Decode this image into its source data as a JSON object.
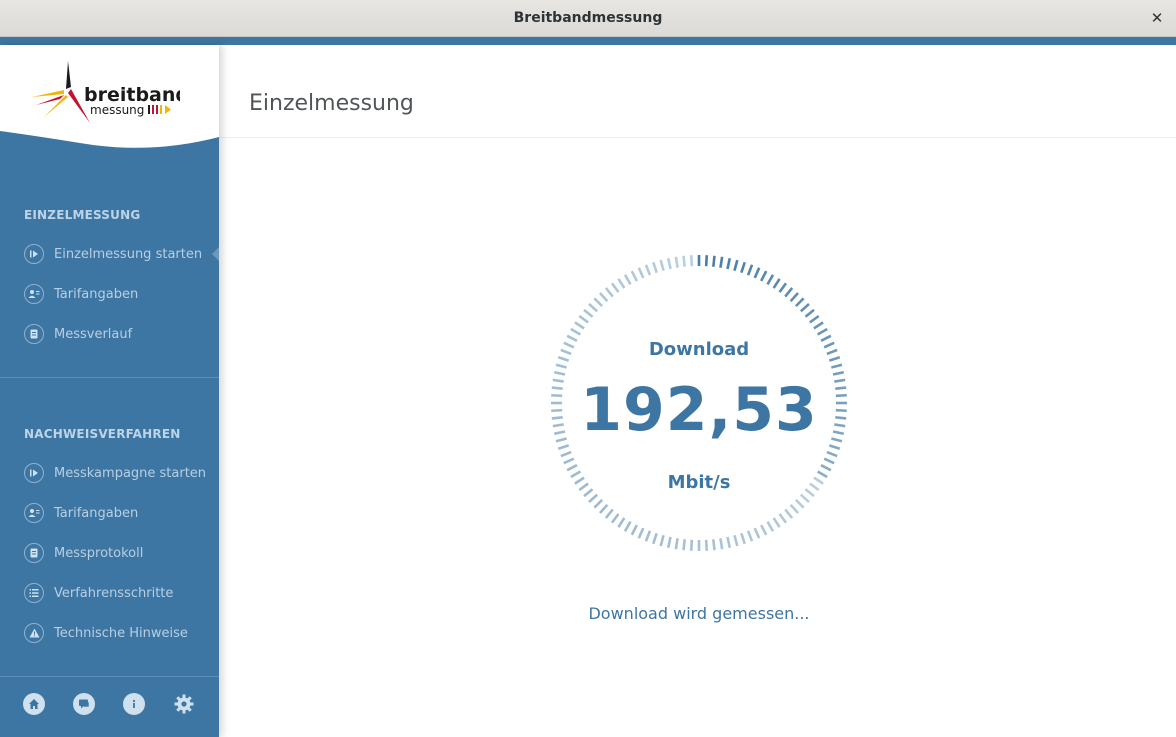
{
  "window": {
    "title": "Breitbandmessung",
    "close_glyph": "✕"
  },
  "logo": {
    "line1": "breitband",
    "line2": "messung"
  },
  "sidebar": {
    "sections": [
      {
        "heading": "EINZELMESSUNG",
        "items": [
          {
            "label": "Einzelmessung starten",
            "icon": "play-circle-icon",
            "active": true
          },
          {
            "label": "Tarifangaben",
            "icon": "user-card-icon"
          },
          {
            "label": "Messverlauf",
            "icon": "document-icon"
          }
        ]
      },
      {
        "heading": "NACHWEISVERFAHREN",
        "items": [
          {
            "label": "Messkampagne starten",
            "icon": "play-circle-icon"
          },
          {
            "label": "Tarifangaben",
            "icon": "user-card-icon"
          },
          {
            "label": "Messprotokoll",
            "icon": "document-icon"
          },
          {
            "label": "Verfahrensschritte",
            "icon": "list-icon"
          },
          {
            "label": "Technische Hinweise",
            "icon": "warning-icon"
          }
        ]
      }
    ],
    "bottom_icons": [
      "home-icon",
      "chat-icon",
      "info-icon",
      "settings-icon"
    ]
  },
  "main": {
    "title": "Einzelmessung",
    "gauge": {
      "caption": "Download",
      "value": "192,53",
      "unit": "Mbit/s"
    },
    "status": "Download wird gemessen..."
  },
  "colors": {
    "accent": "#3e76a3",
    "sidebar_text": "#b7cfe3",
    "heading_text": "#bdd3e6"
  }
}
